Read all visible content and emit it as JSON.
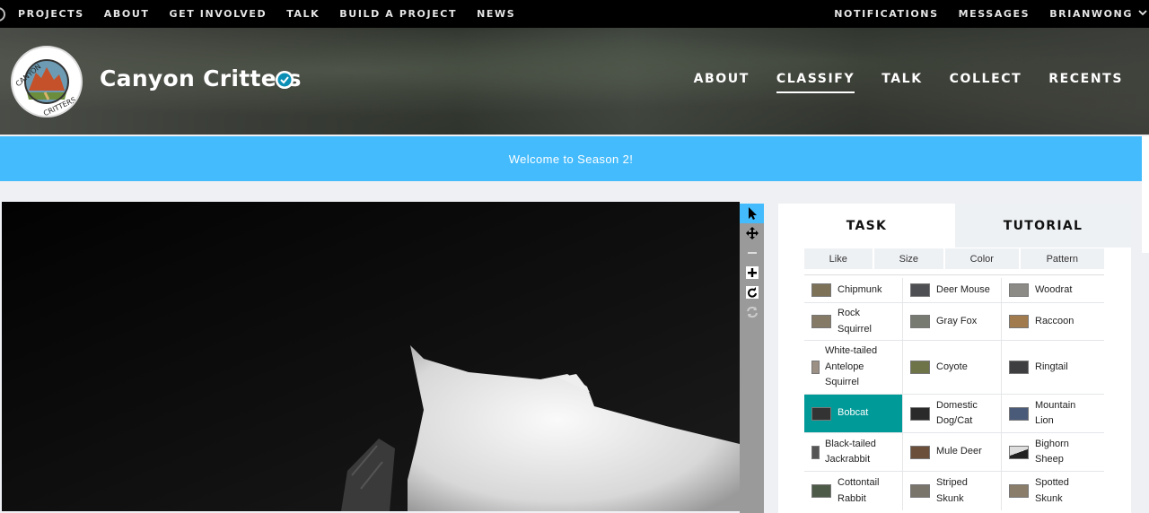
{
  "topnav": {
    "left": [
      "PROJECTS",
      "ABOUT",
      "GET INVOLVED",
      "TALK",
      "BUILD A PROJECT",
      "NEWS"
    ],
    "right": [
      "NOTIFICATIONS",
      "MESSAGES",
      "BRIANWONG"
    ]
  },
  "project": {
    "title": "Canyon Critters",
    "logo_text": "CANYON CRITTERS",
    "nav": [
      "ABOUT",
      "CLASSIFY",
      "TALK",
      "COLLECT",
      "RECENTS"
    ],
    "active_nav": "CLASSIFY"
  },
  "banner": {
    "text": "Welcome to Season 2!"
  },
  "viewer": {
    "tools": [
      "pointer-icon",
      "move-icon",
      "zoom-out-icon",
      "zoom-in-icon",
      "rotate-icon",
      "reset-icon"
    ]
  },
  "task": {
    "tabs": [
      "TASK",
      "TUTORIAL"
    ],
    "filters": [
      "Like",
      "Size",
      "Color",
      "Pattern"
    ],
    "species": [
      [
        "Chipmunk",
        "Deer Mouse",
        "Woodrat"
      ],
      [
        "Rock Squirrel",
        "Gray Fox",
        "Raccoon"
      ],
      [
        "White-tailed Antelope Squirrel",
        "Coyote",
        "Ringtail"
      ],
      [
        "Bobcat",
        "Domestic Dog/Cat",
        "Mountain Lion"
      ],
      [
        "Black-tailed Jackrabbit",
        "Mule Deer",
        "Bighorn Sheep"
      ],
      [
        "Cottontail Rabbit",
        "Striped Skunk",
        "Spotted Skunk"
      ]
    ],
    "selected": "Bobcat"
  },
  "colors": {
    "accent_blue": "#43bbfd",
    "selected_teal": "#009a98"
  }
}
